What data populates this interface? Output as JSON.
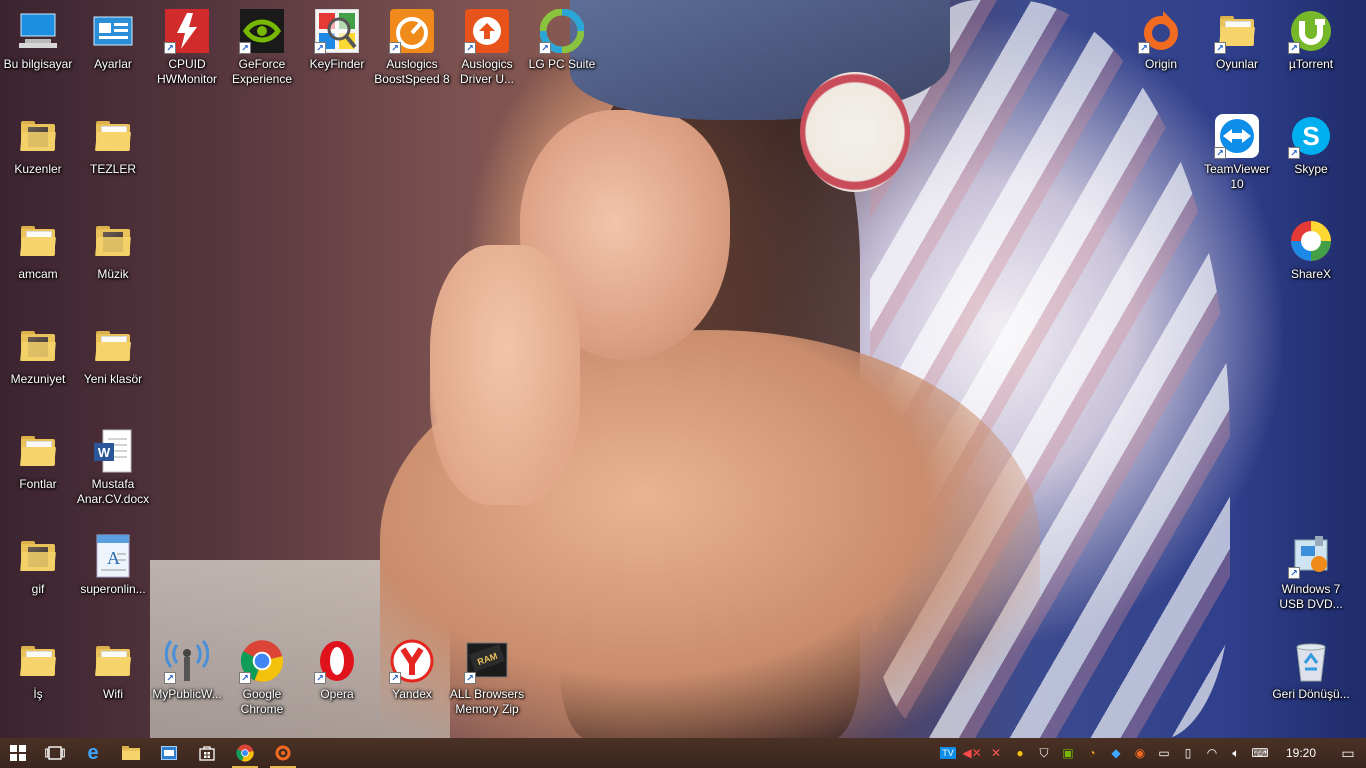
{
  "desktop": {
    "icons": [
      {
        "name": "bu-bilgisayar",
        "label": "Bu bilgisayar",
        "icon": "computer-icon"
      },
      {
        "name": "ayarlar",
        "label": "Ayarlar",
        "icon": "settings-icon"
      },
      {
        "name": "cpuid-hwmonitor",
        "label": "CPUID HWMonitor",
        "icon": "hwmonitor-icon",
        "color": "#d22b2b"
      },
      {
        "name": "geforce-experience",
        "label": "GeForce Experience",
        "icon": "nvidia-icon",
        "color": "#76b900"
      },
      {
        "name": "keyfinder",
        "label": "KeyFinder",
        "icon": "keyfinder-icon"
      },
      {
        "name": "auslogics-boostspeed",
        "label": "Auslogics BoostSpeed 8",
        "icon": "auslogics-icon",
        "color": "#f08a1a"
      },
      {
        "name": "auslogics-driver",
        "label": "Auslogics Driver U...",
        "icon": "auslogics-driver-icon",
        "color": "#e8531c"
      },
      {
        "name": "lg-pc-suite",
        "label": "LG PC Suite",
        "icon": "lg-icon",
        "color": "#2aa7d8"
      },
      {
        "name": "origin",
        "label": "Origin",
        "icon": "origin-icon",
        "color": "#f26b21"
      },
      {
        "name": "oyunlar",
        "label": "Oyunlar",
        "icon": "folder-icon"
      },
      {
        "name": "utorrent",
        "label": "µTorrent",
        "icon": "utorrent-icon",
        "color": "#76b82a"
      },
      {
        "name": "kuzenler",
        "label": "Kuzenler",
        "icon": "folder-photo-icon"
      },
      {
        "name": "tezler",
        "label": "TEZLER",
        "icon": "folder-icon"
      },
      {
        "name": "teamviewer",
        "label": "TeamViewer 10",
        "icon": "teamviewer-icon",
        "color": "#0e8ee9"
      },
      {
        "name": "skype",
        "label": "Skype",
        "icon": "skype-icon",
        "color": "#00aff0"
      },
      {
        "name": "amcam",
        "label": "amcam",
        "icon": "folder-icon"
      },
      {
        "name": "muzik",
        "label": "Müzik",
        "icon": "folder-photo-icon"
      },
      {
        "name": "sharex",
        "label": "ShareX",
        "icon": "sharex-icon"
      },
      {
        "name": "mezuniyet",
        "label": "Mezuniyet",
        "icon": "folder-photo-icon"
      },
      {
        "name": "yeni-klasor",
        "label": "Yeni klasör",
        "icon": "folder-icon"
      },
      {
        "name": "fontlar",
        "label": "Fontlar",
        "icon": "folder-icon"
      },
      {
        "name": "mustafa-cv",
        "label": "Mustafa Anar.CV.docx",
        "icon": "word-doc-icon",
        "color": "#2b579a"
      },
      {
        "name": "gif",
        "label": "gif",
        "icon": "folder-photo-icon"
      },
      {
        "name": "superonline",
        "label": "superonlin...",
        "icon": "text-doc-icon"
      },
      {
        "name": "windows7-usb",
        "label": "Windows 7 USB DVD...",
        "icon": "usb-tool-icon"
      },
      {
        "name": "is",
        "label": "İş",
        "icon": "folder-icon"
      },
      {
        "name": "wifi",
        "label": "Wifi",
        "icon": "folder-icon"
      },
      {
        "name": "mypublicwifi",
        "label": "MyPublicW...",
        "icon": "wifi-antenna-icon"
      },
      {
        "name": "google-chrome",
        "label": "Google Chrome",
        "icon": "chrome-icon"
      },
      {
        "name": "opera",
        "label": "Opera",
        "icon": "opera-icon",
        "color": "#e0121c"
      },
      {
        "name": "yandex",
        "label": "Yandex",
        "icon": "yandex-icon",
        "color": "#e52620"
      },
      {
        "name": "all-browsers-memory-zip",
        "label": "ALL Browsers Memory Zip",
        "icon": "ram-icon"
      },
      {
        "name": "geri-donusum",
        "label": "Geri Dönüşü...",
        "icon": "recycle-bin-icon"
      }
    ]
  },
  "taskbar": {
    "pinned": [
      {
        "name": "start-button",
        "icon": "windows-logo-icon"
      },
      {
        "name": "task-view-button",
        "icon": "task-view-icon"
      },
      {
        "name": "edge-button",
        "icon": "edge-icon"
      },
      {
        "name": "file-explorer-button",
        "icon": "folder-icon"
      },
      {
        "name": "taskbar-app-1",
        "icon": "window-icon"
      },
      {
        "name": "store-button",
        "icon": "store-icon"
      },
      {
        "name": "chrome-taskbar-button",
        "icon": "chrome-icon"
      },
      {
        "name": "origin-taskbar-button",
        "icon": "origin-icon"
      }
    ],
    "clock": "19:20"
  }
}
